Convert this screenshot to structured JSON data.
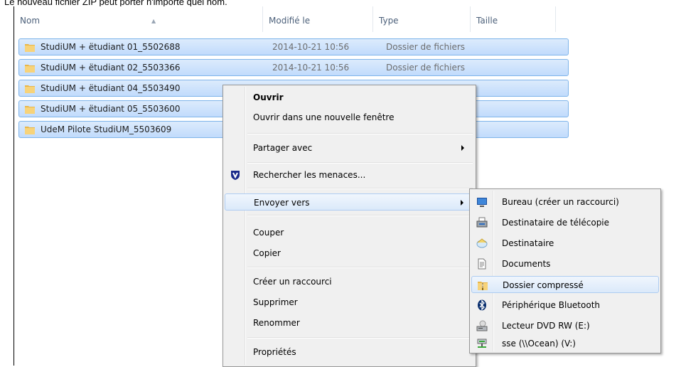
{
  "caption": "Le nouveau fichier ZIP peut porter n'importe quel nom.",
  "columns": {
    "name": "Nom",
    "modified": "Modifié le",
    "type": "Type",
    "size": "Taille"
  },
  "files": [
    {
      "name": "StudiUM + ëtudiant 01_5502688",
      "modified": "2014-10-21 10:56",
      "type": "Dossier de fichiers"
    },
    {
      "name": "StudiUM + ëtudiant 02_5503366",
      "modified": "2014-10-21 10:56",
      "type": "Dossier de fichiers"
    },
    {
      "name": "StudiUM + ëtudiant 04_5503490",
      "modified": "",
      "type": ""
    },
    {
      "name": "StudiUM + ëtudiant 05_5503600",
      "modified": "",
      "type": ""
    },
    {
      "name": "UdeM Pilote StudiUM_5503609",
      "modified": "",
      "type": ""
    }
  ],
  "context_menu": {
    "open": "Ouvrir",
    "open_new_window": "Ouvrir dans une nouvelle fenêtre",
    "share_with": "Partager avec",
    "scan_threats": "Rechercher les menaces...",
    "send_to": "Envoyer vers",
    "cut": "Couper",
    "copy": "Copier",
    "create_shortcut": "Créer un raccourci",
    "delete": "Supprimer",
    "rename": "Renommer",
    "properties": "Propriétés"
  },
  "send_to_menu": {
    "desktop": "Bureau (créer un raccourci)",
    "fax": "Destinataire de télécopie",
    "mail": "Destinataire",
    "documents": "Documents",
    "compressed": "Dossier compressé",
    "bluetooth": "Périphérique Bluetooth",
    "dvd": "Lecteur DVD RW (E:)",
    "network": "sse (\\\\Ocean) (V:)"
  },
  "colors": {
    "selection": "#c1dbfc",
    "selection_border": "#7eb4ea",
    "menu_bg": "#f0f0f0",
    "highlight_border": "#aeccf1"
  }
}
